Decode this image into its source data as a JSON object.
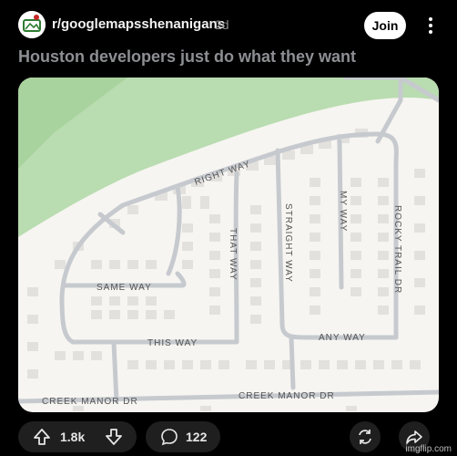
{
  "post": {
    "subreddit": "r/googlemapsshenanigans",
    "age": "2d",
    "join_label": "Join",
    "title": "Houston developers just do what they want"
  },
  "map": {
    "streets": {
      "right_way": "RIGHT WAY",
      "that_way": "THAT WAY",
      "straight_way": "STRAIGHT WAY",
      "my_way": "MY WAY",
      "rocky_trail": "ROCKY TRAIL DR",
      "same_way": "SAME WAY",
      "this_way": "THIS WAY",
      "any_way": "ANY WAY",
      "creek_manor_left": "CREEK MANOR DR",
      "creek_manor_right": "CREEK MANOR DR"
    },
    "colors": {
      "park": "#b9dcb0",
      "road": "#c6cacf",
      "building": "#e3e1dd",
      "land": "#f6f5f1"
    }
  },
  "actions": {
    "upvotes": "1.8k",
    "comments": "122",
    "icons": [
      "upvote-icon",
      "downvote-icon",
      "comment-icon",
      "repost-icon",
      "share-icon"
    ]
  },
  "watermark": "imgflip.com"
}
